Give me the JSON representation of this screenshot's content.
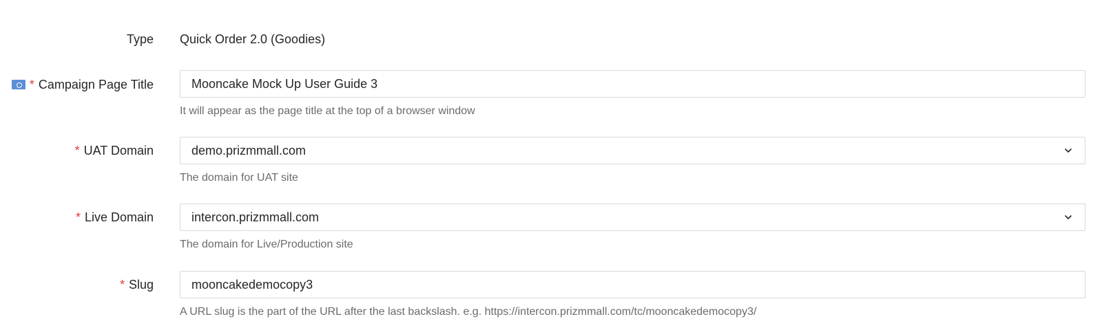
{
  "type_row": {
    "label": "Type",
    "value": "Quick Order 2.0 (Goodies)"
  },
  "campaign_title": {
    "label": "Campaign Page Title",
    "required": "*",
    "value": "Mooncake Mock Up User Guide 3",
    "help": "It will appear as the page title at the top of a browser window"
  },
  "uat_domain": {
    "label": "UAT Domain",
    "required": "*",
    "value": "demo.prizmmall.com",
    "help": "The domain for UAT site"
  },
  "live_domain": {
    "label": "Live Domain",
    "required": "*",
    "value": "intercon.prizmmall.com",
    "help": "The domain for Live/Production site"
  },
  "slug": {
    "label": "Slug",
    "required": "*",
    "value": "mooncakedemocopy3",
    "help": "A URL slug is the part of the URL after the last backslash. e.g. https://intercon.prizmmall.com/tc/mooncakedemocopy3/"
  },
  "colors": {
    "required": "#e23b3b",
    "border": "#d9d9d9",
    "help_text": "#6b6b6b",
    "flag": "#5b8fd6"
  },
  "icons": {
    "language": "language-flag-icon",
    "select_arrow": "chevron-down-icon"
  }
}
